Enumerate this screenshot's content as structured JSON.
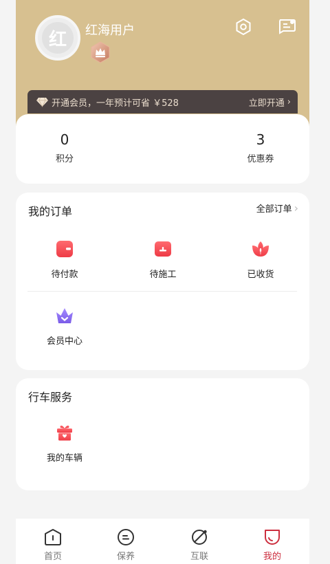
{
  "profile": {
    "avatar_char": "红",
    "username": "红海用户"
  },
  "member_banner": {
    "text": "开通会员，一年预计可省 ￥528",
    "action": "立即开通",
    "action_arrow": "›"
  },
  "stats": [
    {
      "value": "0",
      "label": "积分"
    },
    {
      "value": "3",
      "label": "优惠券"
    }
  ],
  "orders": {
    "title": "我的订单",
    "all_label": "全部订单",
    "all_arrow": "›",
    "items": [
      {
        "label": "待付款",
        "icon": "wallet-icon"
      },
      {
        "label": "待施工",
        "icon": "toolbox-icon"
      },
      {
        "label": "已收货",
        "icon": "lotus-icon"
      },
      {
        "label": "会员中心",
        "icon": "crown-icon"
      }
    ]
  },
  "service": {
    "title": "行车服务",
    "items": [
      {
        "label": "我的车辆",
        "icon": "gift-icon"
      }
    ]
  },
  "nav": {
    "items": [
      {
        "label": "首页",
        "icon": "home-icon"
      },
      {
        "label": "保养",
        "icon": "maintenance-icon"
      },
      {
        "label": "互联",
        "icon": "planet-icon"
      },
      {
        "label": "我的",
        "icon": "profile-icon",
        "active": true
      }
    ]
  },
  "colors": {
    "header_bg": "#d7c090",
    "member_bar_bg": "#4b4242",
    "accent_red": "#f0434d",
    "vip_purple": "#8a6cf0",
    "nav_active": "#cc2e3e"
  }
}
